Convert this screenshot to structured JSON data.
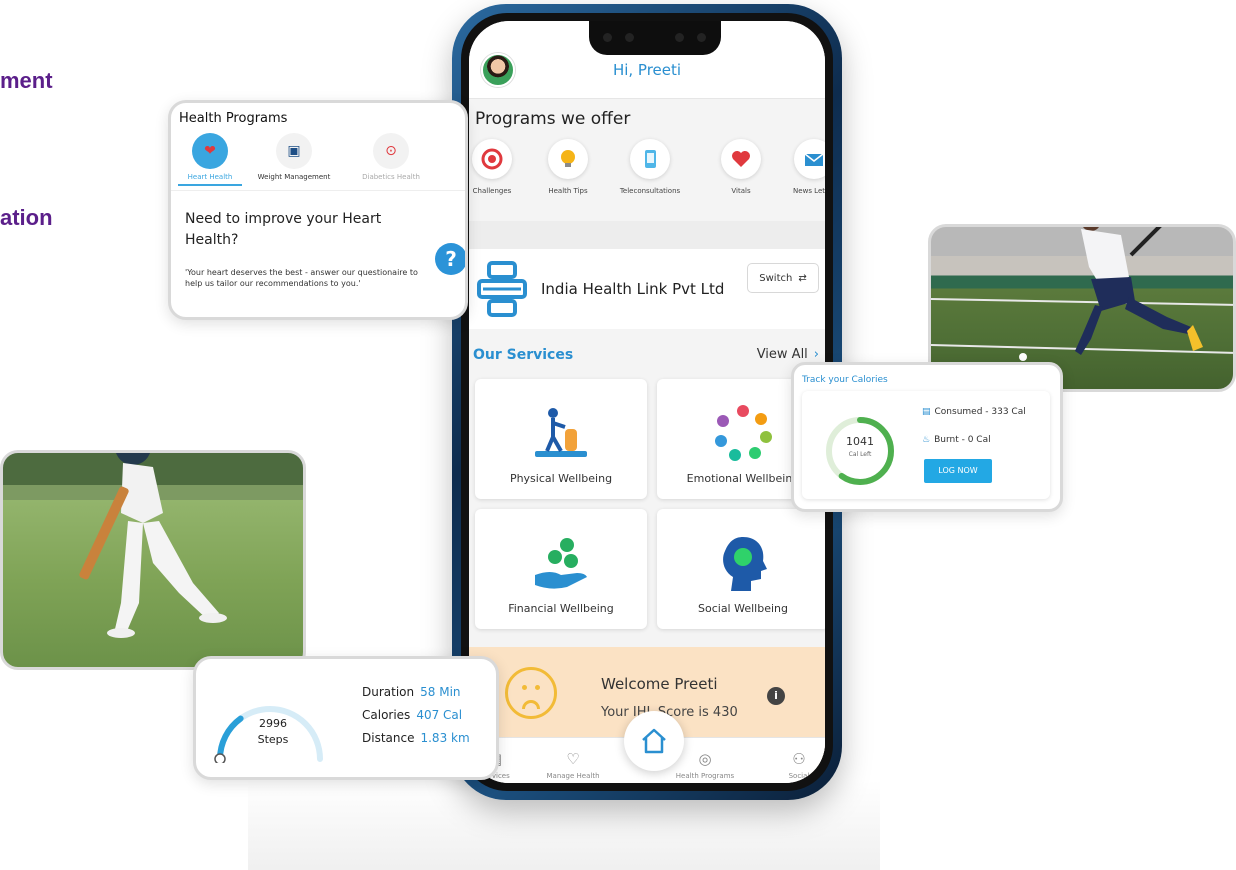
{
  "left_heading": {
    "line1": "ment",
    "line2": "ation"
  },
  "app": {
    "greeting": "Hi, Preeti",
    "programs_title": "Programs we offer",
    "programs": [
      {
        "label": "Challenges",
        "icon": "target-icon"
      },
      {
        "label": "Health Tips",
        "icon": "bulb-icon"
      },
      {
        "label": "Teleconsultations",
        "icon": "phone-doctor-icon"
      },
      {
        "label": "Vitals",
        "icon": "heart-icon"
      },
      {
        "label": "News Letter",
        "icon": "mail-icon"
      }
    ],
    "company_name": "India Health Link Pvt Ltd",
    "switch_label": "Switch",
    "services_title": "Our Services",
    "view_all": "View All",
    "services": [
      {
        "label": "Physical Wellbeing",
        "icon": "yoga-icon"
      },
      {
        "label": "Emotional Wellbeing",
        "icon": "people-circle-icon"
      },
      {
        "label": "Financial Wellbeing",
        "icon": "money-hand-icon"
      },
      {
        "label": "Social Wellbeing",
        "icon": "head-gear-icon"
      }
    ],
    "welcome_title": "Welcome Preeti",
    "welcome_score": "Your IHL Score is 430",
    "bottom_nav": [
      {
        "label": "Services",
        "icon": "services-icon"
      },
      {
        "label": "Manage Health",
        "icon": "manage-health-icon"
      },
      {
        "label": "Health Programs",
        "icon": "programs-icon"
      },
      {
        "label": "Social",
        "icon": "social-icon"
      }
    ]
  },
  "health_programs_card": {
    "title": "Health Programs",
    "tabs": [
      {
        "label": "Heart Health",
        "icon": "heart-icon",
        "active": true
      },
      {
        "label": "Weight Management",
        "icon": "scale-icon",
        "active": false
      },
      {
        "label": "Diabetics Health",
        "icon": "glucose-icon",
        "active": false
      }
    ],
    "question": "Need to improve your Heart Health?",
    "body": "'Your heart deserves the best - answer our questionaire to help us tailor our recommendations to you.'"
  },
  "calories_card": {
    "title": "Track your Calories",
    "calories_left": "1041",
    "calories_left_label": "Cal Left",
    "consumed": "Consumed - 333 Cal",
    "burnt": "Burnt - 0 Cal",
    "log_button": "LOG NOW",
    "progress_fraction": 0.6
  },
  "steps_card": {
    "steps": "2996",
    "steps_label": "Steps",
    "duration_label": "Duration",
    "duration_value": "58 Min",
    "calories_label": "Calories",
    "calories_value": "407 Cal",
    "distance_label": "Distance",
    "distance_value": "1.83 km",
    "progress_fraction": 0.3
  },
  "colors": {
    "accent": "#2a8fd0",
    "brand_purple": "#5b1f8a",
    "welcome_bg": "#fbe2c4"
  }
}
